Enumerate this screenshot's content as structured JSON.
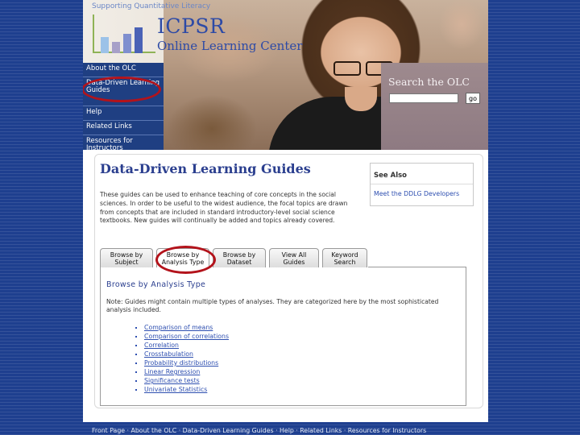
{
  "header": {
    "tagline": "Supporting Quantitative Literacy",
    "brand": "ICPSR",
    "brand_sub": "Online Learning Center"
  },
  "nav": {
    "items": [
      {
        "label": "About the OLC"
      },
      {
        "label": "Data-Driven Learning Guides"
      },
      {
        "label": "Help"
      },
      {
        "label": "Related Links"
      },
      {
        "label": "Resources for Instructors"
      }
    ]
  },
  "search": {
    "title": "Search the OLC",
    "input_value": "",
    "button_label": "go"
  },
  "content": {
    "title": "Data-Driven Learning Guides",
    "intro": "These guides can be used to enhance teaching of core concepts in the social sciences. In order to be useful to the widest audience, the focal topics are drawn from concepts that are included in standard introductory-level social science textbooks. New guides will continually be added and topics already covered.",
    "see_also": {
      "title": "See Also",
      "link": "Meet the DDLG Developers"
    },
    "tabs": [
      {
        "label": "Browse by Subject",
        "active": false
      },
      {
        "label": "Browse by Analysis Type",
        "active": true
      },
      {
        "label": "Browse by Dataset",
        "active": false
      },
      {
        "label": "View All Guides",
        "active": false
      },
      {
        "label": "Keyword Search",
        "active": false
      }
    ],
    "panel": {
      "title": "Browse by Analysis Type",
      "note": "Note: Guides might contain multiple types of analyses. They are categorized here by the most sophisticated analysis included.",
      "items": [
        "Comparison of means",
        "Comparison of correlations",
        "Correlation",
        "Crosstabulation",
        "Probability distributions",
        "Linear Regression",
        "Significance tests",
        "Univariate Statistics"
      ]
    }
  },
  "footer": {
    "text": "Front Page  ·  About the OLC  ·  Data-Driven Learning Guides  ·  Help  ·  Related Links  ·  Resources for Instructors"
  },
  "colors": {
    "background": "#1e3f8f",
    "nav": "#1f3f82",
    "title": "#2b3f8f",
    "link": "#2e4fb0",
    "annotation": "#b3131b"
  }
}
